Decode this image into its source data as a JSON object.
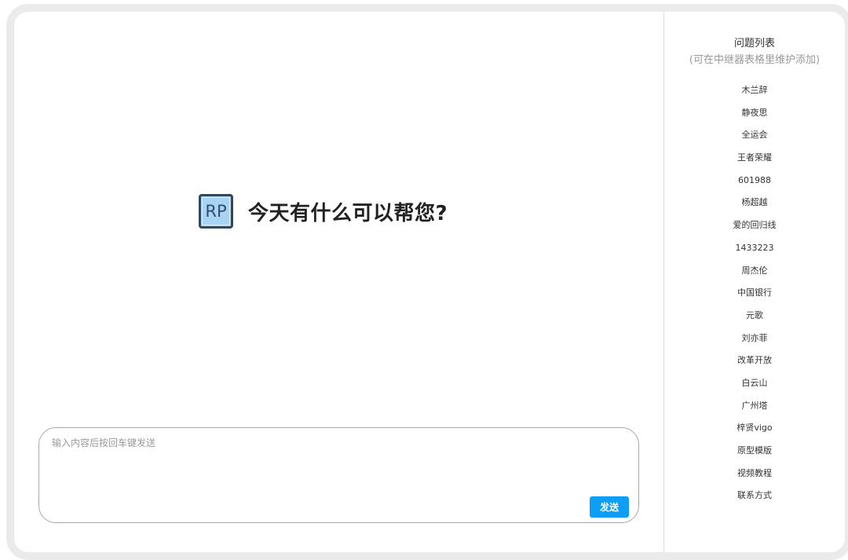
{
  "main": {
    "logo_text": "RP",
    "greeting": "今天有什么可以帮您?",
    "input": {
      "placeholder": "输入内容后按回车键发送",
      "value": ""
    },
    "send_label": "发送"
  },
  "sidebar": {
    "title": "问题列表",
    "subtitle": "(可在中继器表格里维护添加)",
    "items": [
      {
        "label": "木兰辞"
      },
      {
        "label": "静夜思"
      },
      {
        "label": "全运会"
      },
      {
        "label": "王者荣耀"
      },
      {
        "label": "601988"
      },
      {
        "label": "杨超越"
      },
      {
        "label": "爱的回归线"
      },
      {
        "label": "1433223"
      },
      {
        "label": "周杰伦"
      },
      {
        "label": "中国银行"
      },
      {
        "label": "元歌"
      },
      {
        "label": "刘亦菲"
      },
      {
        "label": "改革开放"
      },
      {
        "label": "白云山"
      },
      {
        "label": "广州塔"
      },
      {
        "label": "梓贤vigo"
      },
      {
        "label": "原型模版"
      },
      {
        "label": "视频教程"
      },
      {
        "label": "联系方式"
      }
    ]
  },
  "colors": {
    "send_button": "#0e9ef6",
    "logo_bg": "#a9d3f2",
    "logo_border": "#33475b",
    "frame_border": "#ebebeb"
  }
}
